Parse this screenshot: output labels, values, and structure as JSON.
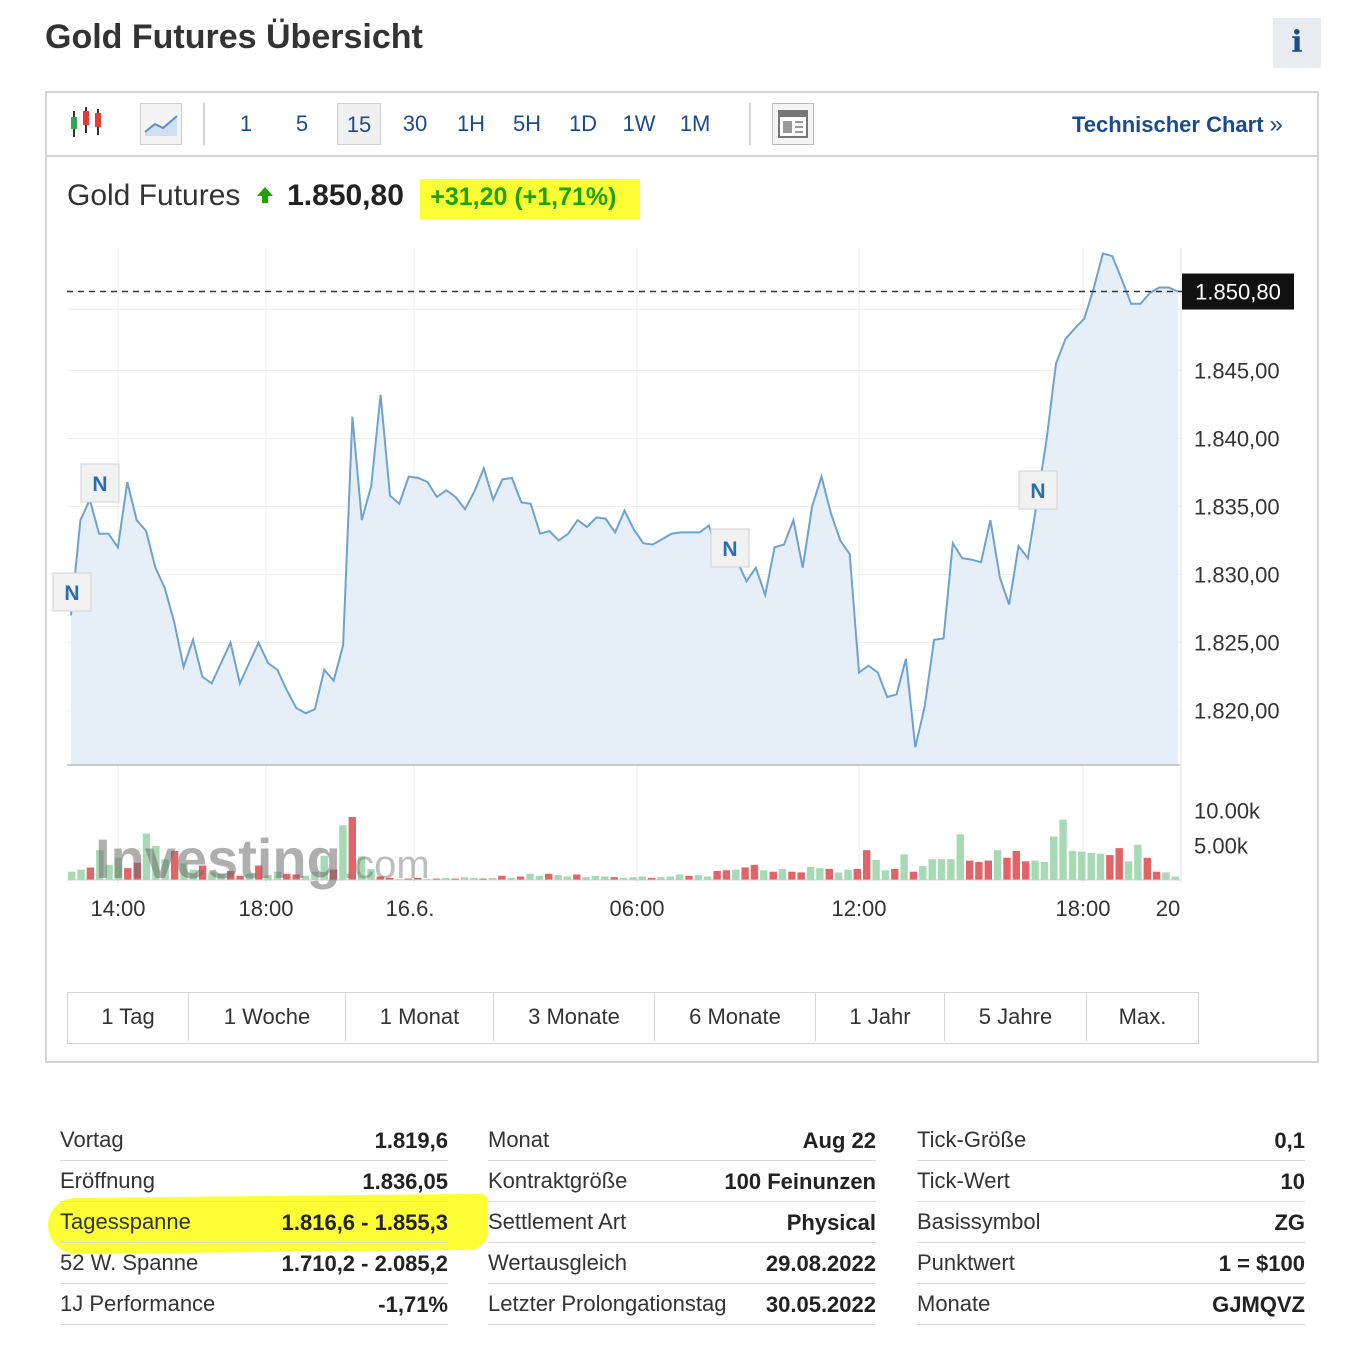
{
  "page": {
    "title": "Gold Futures Übersicht",
    "info_label": "i"
  },
  "toolbar": {
    "timeframes": [
      "1",
      "5",
      "15",
      "30",
      "1H",
      "5H",
      "1D",
      "1W",
      "1M"
    ],
    "active_timeframe": "15",
    "tech_chart_label": "Technischer Chart",
    "tech_chart_arrow": "»",
    "icons": [
      "candlestick-chart-icon",
      "line-chart-icon",
      "layout-icon"
    ]
  },
  "quote": {
    "name": "Gold Futures",
    "price": "1.850,80",
    "change": "+31,20 (+1,71%)",
    "direction": "up",
    "up_color": "#1fa300"
  },
  "chart_data": {
    "type": "area",
    "x_tick_labels": [
      "14:00",
      "18:00",
      "16.6.",
      "06:00",
      "12:00",
      "18:00",
      "20"
    ],
    "y_tick_labels": [
      "1.820,00",
      "1.825,00",
      "1.830,00",
      "1.835,00",
      "1.840,00",
      "1.845,00"
    ],
    "y_ticks": [
      1820,
      1825,
      1830,
      1835,
      1840,
      1845
    ],
    "ylim": [
      1816,
      1854
    ],
    "last_price": 1850.8,
    "last_price_label": "1.850,80",
    "series": [
      {
        "values": [
          1827,
          1834,
          1835.5,
          1833,
          1833,
          1832,
          1836.8,
          1834,
          1833.2,
          1830.5,
          1829,
          1826.5,
          1823.2,
          1825.2,
          1822.5,
          1822,
          1823.5,
          1825,
          1822,
          1823.5,
          1825,
          1823.5,
          1823,
          1821.5,
          1820.2,
          1819.8,
          1820.1,
          1823,
          1822.2,
          1824.8,
          1841.6,
          1834,
          1836.5,
          1843.2,
          1835.8,
          1835.2,
          1837.2,
          1837.1,
          1836.8,
          1835.7,
          1836.2,
          1835.7,
          1834.8,
          1836.1,
          1837.8,
          1835.5,
          1837,
          1837.1,
          1835.3,
          1835.2,
          1833,
          1833.2,
          1832.5,
          1833,
          1834,
          1833.5,
          1834.2,
          1834.1,
          1833.1,
          1834.7,
          1833.3,
          1832.3,
          1832.2,
          1832.6,
          1833,
          1833.1,
          1833.1,
          1833.1,
          1833.6,
          1831.5,
          1833,
          1831,
          1829.5,
          1830.5,
          1828.5,
          1832,
          1832.2,
          1834,
          1830.5,
          1835,
          1837.2,
          1834.5,
          1832.5,
          1831.5,
          1822.8,
          1823.3,
          1822.8,
          1821,
          1821.2,
          1823.8,
          1817.3,
          1820.3,
          1825.2,
          1825.3,
          1832.3,
          1831.2,
          1831.1,
          1830.9,
          1834,
          1829.8,
          1827.8,
          1832.1,
          1831.2,
          1835.5,
          1840,
          1845.5,
          1847.3,
          1848.1,
          1848.8,
          1851,
          1853.6,
          1853.4,
          1851.7,
          1849.9,
          1849.9,
          1850.7,
          1851.1,
          1851.1,
          1850.8
        ]
      }
    ],
    "news_markers": [
      "N",
      "N",
      "N",
      "N"
    ],
    "volume": {
      "tick_labels": [
        "10.00k",
        "5.00k"
      ],
      "ticks": [
        10000,
        5000
      ],
      "ylim": [
        0,
        14000
      ],
      "up_color": "#a6d9b4",
      "down_color": "#e06468",
      "values": [
        1200,
        1500,
        -1800,
        4300,
        2200,
        3200,
        -1700,
        -2500,
        6700,
        4900,
        3000,
        -4200,
        2400,
        1500,
        -2100,
        1100,
        900,
        -1300,
        -600,
        900,
        -2100,
        700,
        1200,
        -900,
        -800,
        600,
        1200,
        3500,
        -1500,
        7900,
        -9100,
        3400,
        1600,
        -500,
        -300,
        -100,
        -200,
        -300,
        -100,
        -200,
        300,
        -200,
        400,
        300,
        -200,
        300,
        -600,
        300,
        -500,
        900,
        600,
        -900,
        700,
        500,
        -800,
        400,
        600,
        500,
        -400,
        300,
        400,
        500,
        -300,
        400,
        500,
        800,
        -600,
        700,
        500,
        -1300,
        -1400,
        1500,
        -1800,
        -2200,
        1400,
        -1200,
        1600,
        -1200,
        -1100,
        1900,
        1700,
        -1600,
        1100,
        1500,
        -1600,
        -4300,
        2900,
        1400,
        -1600,
        3700,
        -1200,
        2000,
        3000,
        3000,
        3000,
        6600,
        -2800,
        -2600,
        -2800,
        4300,
        -3200,
        -4200,
        -2700,
        2800,
        2600,
        6300,
        8700,
        4200,
        4100,
        3900,
        3800,
        -3600,
        -4600,
        2700,
        5100,
        -3200,
        -1200,
        1100,
        500
      ]
    }
  },
  "watermark": {
    "text": "Investing",
    "suffix": ".com"
  },
  "range_buttons": [
    "1 Tag",
    "1 Woche",
    "1 Monat",
    "3 Monate",
    "6 Monate",
    "1 Jahr",
    "5 Jahre",
    "Max."
  ],
  "stats": {
    "col1": [
      {
        "label": "Vortag",
        "value": "1.819,6"
      },
      {
        "label": "Eröffnung",
        "value": "1.836,05"
      },
      {
        "label": "Tagesspanne",
        "value": "1.816,6 - 1.855,3"
      },
      {
        "label": "52 W. Spanne",
        "value": "1.710,2 - 2.085,2"
      },
      {
        "label": "1J Performance",
        "value": "-1,71%"
      }
    ],
    "col2": [
      {
        "label": "Monat",
        "value": "Aug 22"
      },
      {
        "label": "Kontraktgröße",
        "value": "100 Feinunzen"
      },
      {
        "label": "Settlement Art",
        "value": "Physical"
      },
      {
        "label": "Wertausgleich",
        "value": "29.08.2022"
      },
      {
        "label": "Letzter Prolongationstag",
        "value": "30.05.2022"
      }
    ],
    "col3": [
      {
        "label": "Tick-Größe",
        "value": "0,1"
      },
      {
        "label": "Tick-Wert",
        "value": "10"
      },
      {
        "label": "Basissymbol",
        "value": "ZG"
      },
      {
        "label": "Punktwert",
        "value": "1 = $100"
      },
      {
        "label": "Monate",
        "value": "GJMQVZ"
      }
    ]
  },
  "colors": {
    "link": "#1a4b8a",
    "highlight": "#fbff34",
    "line": "#6ea3cf",
    "area": "#e6eef7"
  }
}
